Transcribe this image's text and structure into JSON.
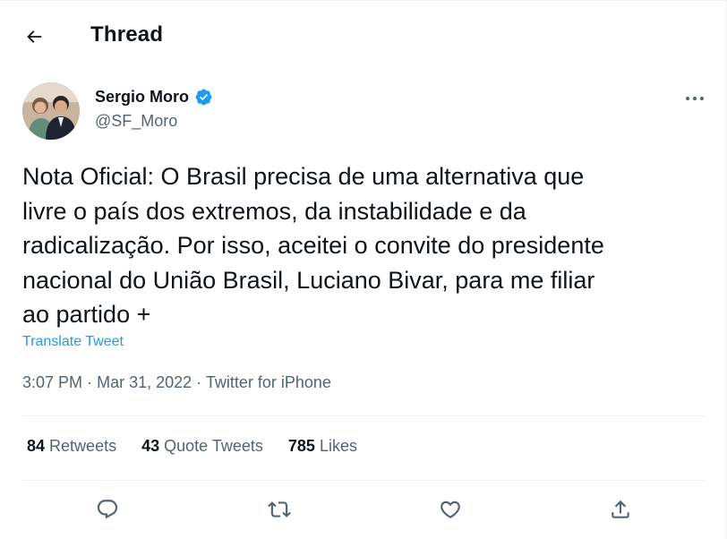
{
  "header": {
    "title": "Thread",
    "back_icon": "arrow-left-icon"
  },
  "author": {
    "name": "Sergio Moro",
    "handle": "@SF_Moro",
    "verified": true,
    "verified_color": "#1d9bf0"
  },
  "tweet": {
    "text": "Nota Oficial: O Brasil precisa de uma alternativa que\nlivre o país dos extremos, da instabilidade e da\nradicalização. Por isso, aceitei o convite do presidente\nnacional do União Brasil, Luciano Bivar, para me filiar\nao partido +",
    "translate_label": "Translate Tweet",
    "time": "3:07 PM",
    "date": "Mar 31, 2022",
    "source": "Twitter for iPhone",
    "separator": "·"
  },
  "stats": {
    "retweets_count": "84",
    "retweets_label": "Retweets",
    "quotes_count": "43",
    "quotes_label": "Quote Tweets",
    "likes_count": "785",
    "likes_label": "Likes"
  },
  "actions": [
    "reply-icon",
    "retweet-icon",
    "like-icon",
    "share-icon"
  ],
  "colors": {
    "accent": "#1d9bf0",
    "secondary_text": "#536471",
    "divider": "#eff3f4"
  }
}
